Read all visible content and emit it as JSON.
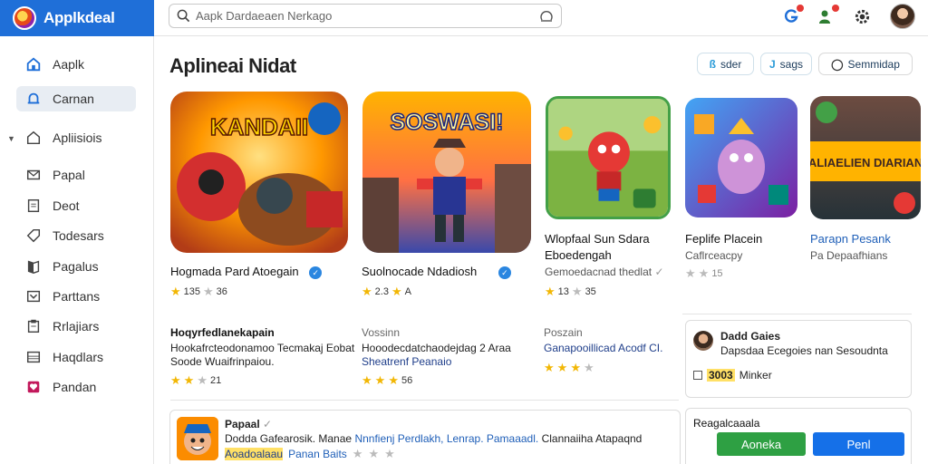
{
  "app": {
    "name": "Applkdeal"
  },
  "search": {
    "placeholder": "Aapk Dardaeaen Nerkago"
  },
  "sidebar": {
    "items": [
      {
        "label": "Aaplk",
        "icon": "home-icon"
      },
      {
        "label": "Carnan",
        "icon": "bell-icon"
      },
      {
        "label": "Apliisiois",
        "icon": "home-outline-icon"
      },
      {
        "label": "Papal",
        "icon": "mail-icon"
      },
      {
        "label": "Deot",
        "icon": "document-icon"
      },
      {
        "label": "Todesars",
        "icon": "tag-icon"
      },
      {
        "label": "Pagalus",
        "icon": "book-icon"
      },
      {
        "label": "Parttans",
        "icon": "inbox-icon"
      },
      {
        "label": "Rrlajiars",
        "icon": "clipboard-icon"
      },
      {
        "label": "Haqdlars",
        "icon": "list-icon"
      },
      {
        "label": "Pandan",
        "icon": "heart-icon"
      }
    ]
  },
  "main": {
    "title": "Aplineai Nidat",
    "pills": [
      {
        "icon": "ß",
        "label": "sder"
      },
      {
        "icon": "J",
        "label": "sags"
      },
      {
        "icon": "◯",
        "label": "Semmidap"
      }
    ]
  },
  "featured": [
    {
      "art_text": "KANDAII",
      "title": "Hogmada Pard Atoegain",
      "rating": "135",
      "rating2": "36",
      "stars": 1
    },
    {
      "art_text": "SOSWASI!",
      "title": "Suolnocade Ndadiosh",
      "rating": "2.3",
      "rating2": "A",
      "stars": 2
    },
    {
      "art_text": "",
      "title": "Wlopfaal Sun Sdara",
      "sub_title": "Eboedengah",
      "sub": "Gemoedacnad thedlat",
      "rating": "13",
      "rating2": "35",
      "stars": 1
    },
    {
      "art_text": "",
      "title": "Feplife Placein",
      "sub": "Caflrceacpy",
      "rating": "15",
      "stars": 0
    },
    {
      "art_text": "ALIAELIEN DIARIAN",
      "title": "Parapn Pesank",
      "sub": "Pa Depaafhians",
      "stars": 0
    }
  ],
  "list": [
    {
      "title": "Hoqyrfedlanekapain",
      "line1": "Hookafrcteodonamoo Tecmakaj Eobat",
      "line2": "Soode Wuaifrinpaiou.",
      "rating": "21",
      "blue": false
    },
    {
      "title": "Vossinn",
      "line1": "Hooodecdatchaodejdag 2 Araa",
      "line2": "Sheatrenf Peanaio",
      "rating": "56",
      "blue": true
    },
    {
      "title": "Poszain",
      "line1": "Ganapooillicad Acodf CI.",
      "line2": "",
      "rating": "",
      "blue": true
    }
  ],
  "profile_card": {
    "name": "Dadd Gaies",
    "desc": "Dapsdaa Ecegoies nan Sesoudnta",
    "tag": "3003",
    "link": "Minker"
  },
  "bottom_item": {
    "title": "Papaal",
    "desc_a": "Dodda Gafearosik. Manae",
    "desc_b": "Nnnfienj Perdlakh, Lenrap. Pamaaadl.",
    "desc_c": "Clannaiiha Atapaqnd",
    "dev_a": "Aoadoalaau",
    "dev_b": "Panan Baits",
    "stars": 3
  },
  "action_card": {
    "title": "Reagalcaaala",
    "btn_green": "Aoneka",
    "btn_blue": "Penl"
  },
  "colors": {
    "brand": "#1f6fd8",
    "green_button": "#2ea043",
    "blue_button": "#1570e8",
    "star": "#f2b705"
  }
}
